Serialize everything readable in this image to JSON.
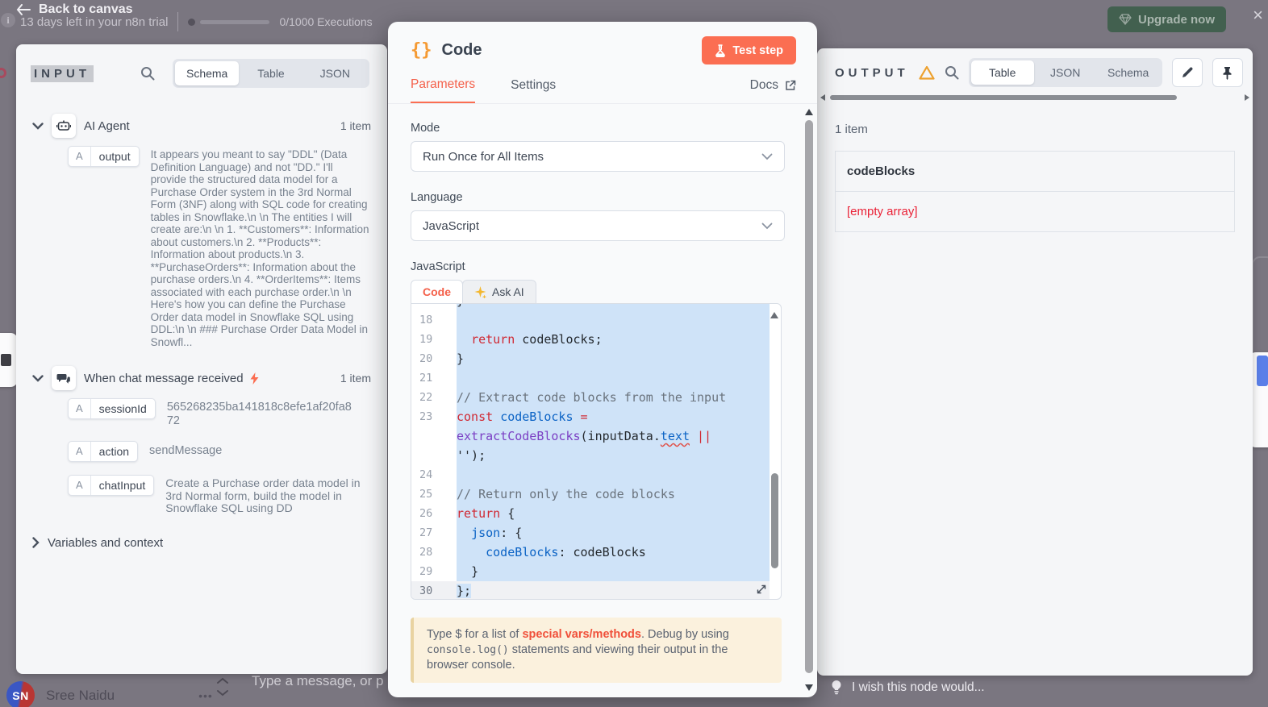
{
  "topbar": {
    "back_label": "Back to canvas",
    "trial_text": "13 days left in your n8n trial",
    "executions_text": "0/1000 Executions",
    "upgrade_label": "Upgrade now",
    "close_label": "×",
    "info_label": "i"
  },
  "input_panel": {
    "title": "INPUT",
    "tabs": [
      "Schema",
      "Table",
      "JSON"
    ],
    "active_tab": "Schema",
    "ai_agent": {
      "label": "AI Agent",
      "count": "1 item",
      "field_type": "A",
      "field_name": "output",
      "field_value": "It appears you meant to say \"DDL\" (Data Definition Language) and not \"DD.\" I'll provide the structured data model for a Purchase Order system in the 3rd Normal Form (3NF) along with SQL code for creating tables in Snowflake.\\n \\n The entities I will create are:\\n \\n 1. **Customers**: Information about customers.\\n 2. **Products**: Information about products.\\n 3. **PurchaseOrders**: Information about the purchase orders.\\n 4. **OrderItems**: Items associated with each purchase order.\\n \\n Here's how you can define the Purchase Order data model in Snowflake SQL using DDL:\\n \\n ### Purchase Order Data Model in Snowfl..."
    },
    "chat_trigger": {
      "label": "When chat message received",
      "count": "1 item",
      "fields": [
        {
          "type": "A",
          "name": "sessionId",
          "value": "565268235ba141818c8efe1af20fa872"
        },
        {
          "type": "A",
          "name": "action",
          "value": "sendMessage"
        },
        {
          "type": "A",
          "name": "chatInput",
          "value": "Create a Purchase order data model in 3rd Normal form, build the model in Snowflake SQL using DD"
        }
      ]
    },
    "variables_label": "Variables and context"
  },
  "modal": {
    "title": "Code",
    "test_step_label": "Test step",
    "tabs": {
      "parameters": "Parameters",
      "settings": "Settings",
      "docs": "Docs"
    },
    "mode": {
      "label": "Mode",
      "value": "Run Once for All Items"
    },
    "language": {
      "label": "Language",
      "value": "JavaScript"
    },
    "editor": {
      "section_label": "JavaScript",
      "code_tab": "Code",
      "ask_ai_tab": "Ask AI",
      "lines": [
        {
          "n": "",
          "clip": true,
          "sel": true,
          "seg": [
            [
              "pl",
              "}"
            ]
          ]
        },
        {
          "n": "18",
          "sel": true,
          "seg": []
        },
        {
          "n": "19",
          "sel": true,
          "seg": [
            [
              "pl",
              "  "
            ],
            [
              "kw",
              "return"
            ],
            [
              "pl",
              " codeBlocks;"
            ]
          ]
        },
        {
          "n": "20",
          "sel": true,
          "seg": [
            [
              "pl",
              "}"
            ]
          ]
        },
        {
          "n": "21",
          "sel": true,
          "seg": []
        },
        {
          "n": "22",
          "sel": true,
          "seg": [
            [
              "cm",
              "// Extract code blocks from the input"
            ]
          ]
        },
        {
          "n": "23",
          "sel": true,
          "seg": [
            [
              "kw",
              "const"
            ],
            [
              "pl",
              " "
            ],
            [
              "vr",
              "codeBlocks"
            ],
            [
              "pl",
              " "
            ],
            [
              "op",
              "="
            ],
            [
              "pl",
              " "
            ],
            [
              "fn",
              "extractCodeBlocks"
            ],
            [
              "pl",
              "(inputData."
            ],
            [
              "er",
              "text"
            ],
            [
              "pl",
              " "
            ],
            [
              "op",
              "||"
            ],
            [
              "pl",
              " '');"
            ]
          ]
        },
        {
          "n": "24",
          "sel": true,
          "seg": []
        },
        {
          "n": "25",
          "sel": true,
          "seg": [
            [
              "cm",
              "// Return only the code blocks"
            ]
          ]
        },
        {
          "n": "26",
          "sel": true,
          "seg": [
            [
              "kw",
              "return"
            ],
            [
              "pl",
              " {"
            ]
          ]
        },
        {
          "n": "27",
          "sel": true,
          "seg": [
            [
              "pl",
              "  "
            ],
            [
              "vr",
              "json"
            ],
            [
              "pl",
              ": {"
            ]
          ]
        },
        {
          "n": "28",
          "sel": true,
          "seg": [
            [
              "pl",
              "    "
            ],
            [
              "vr",
              "codeBlocks"
            ],
            [
              "pl",
              ": codeBlocks"
            ]
          ]
        },
        {
          "n": "29",
          "sel": true,
          "seg": [
            [
              "pl",
              "  }"
            ]
          ]
        },
        {
          "n": "30",
          "active": true,
          "seg": [
            [
              "ps",
              "};"
            ]
          ]
        }
      ]
    },
    "hint": {
      "pre": "Type $ for a list of ",
      "link": "special vars/methods",
      "mid": ". Debug by using ",
      "code": "console.log()",
      "post": " statements and viewing their output in the browser console."
    }
  },
  "output_panel": {
    "title": "OUTPUT",
    "tabs": [
      "Table",
      "JSON",
      "Schema"
    ],
    "active_tab": "Table",
    "count": "1 item",
    "table": {
      "header": "codeBlocks",
      "value": "[empty array]"
    },
    "wish_text": "I wish this node would..."
  },
  "statusbar": {
    "user_initials": "SN",
    "user_name": "Sree Naidu",
    "menu_dots": "•••",
    "ghost_message": "Type a message, or p"
  },
  "colors": {
    "primary": "#fb6e52",
    "warning": "#eda12f",
    "error_red": "#ea2136",
    "selection_blue": "#cfe3f8",
    "upgrade_green": "#42604f"
  }
}
